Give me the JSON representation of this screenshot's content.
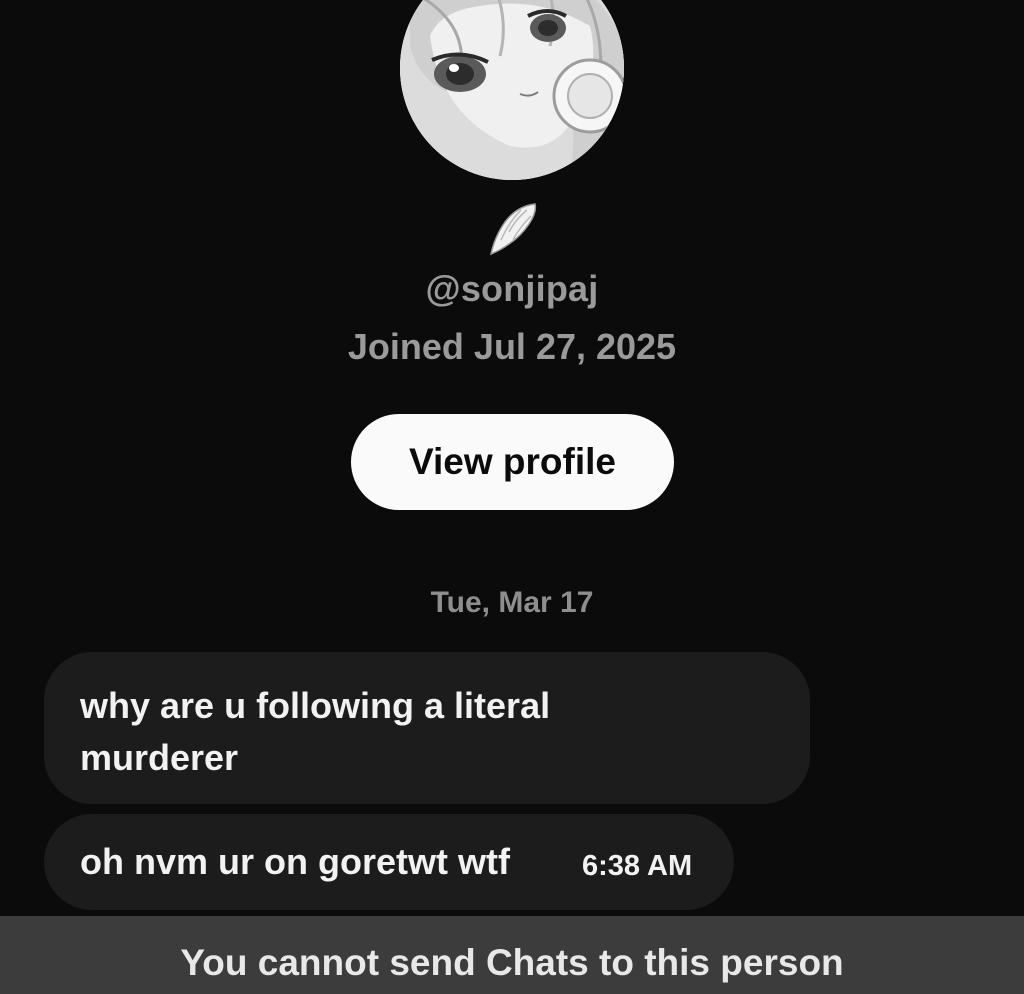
{
  "profile": {
    "handle": "@sonjipaj",
    "joined": "Joined Jul 27, 2025",
    "avatar_icon": "anime-girl-avatar",
    "badge_icon": "wing-icon"
  },
  "actions": {
    "view_profile_label": "View profile"
  },
  "conversation": {
    "date_separator": "Tue, Mar 17",
    "messages": [
      {
        "text": "why are u following a literal murderer",
        "time": ""
      },
      {
        "text": "oh nvm ur on goretwt wtf",
        "time": "6:38 AM"
      }
    ]
  },
  "footer": {
    "notice": "You cannot send Chats to this person"
  },
  "colors": {
    "background": "#0b0b0b",
    "bubble": "#1c1c1c",
    "button": "#fafafa",
    "footer": "#3c3c3c",
    "muted_text": "#9a9a9a"
  }
}
